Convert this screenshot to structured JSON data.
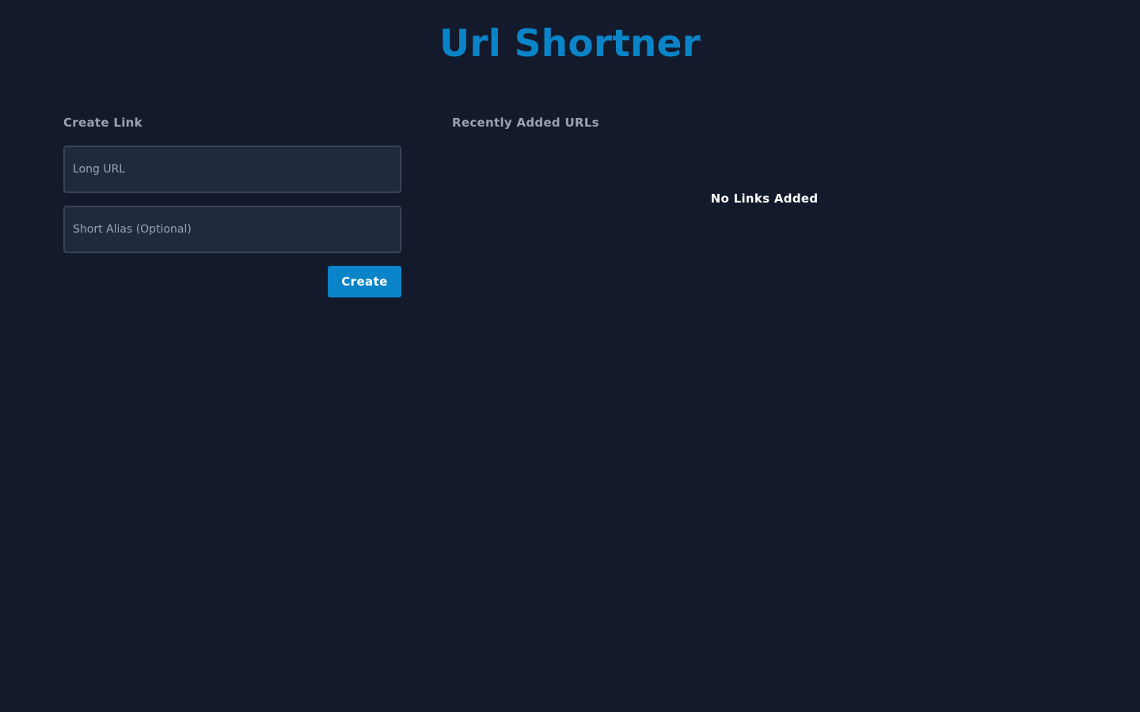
{
  "app": {
    "title": "Url Shortner"
  },
  "create_link": {
    "heading": "Create Link",
    "long_url": {
      "placeholder": "Long URL",
      "value": ""
    },
    "short_alias": {
      "placeholder": "Short Alias (Optional)",
      "value": ""
    },
    "submit_label": "Create"
  },
  "recent": {
    "heading": "Recently Added URLs",
    "empty_message": "No Links Added",
    "links": []
  },
  "colors": {
    "background": "#131a2b",
    "accent": "#0a84c8",
    "input_background": "#1f2a3c",
    "input_border": "#3a4456",
    "muted_text": "#9aa3b2",
    "primary_text": "#ffffff"
  }
}
